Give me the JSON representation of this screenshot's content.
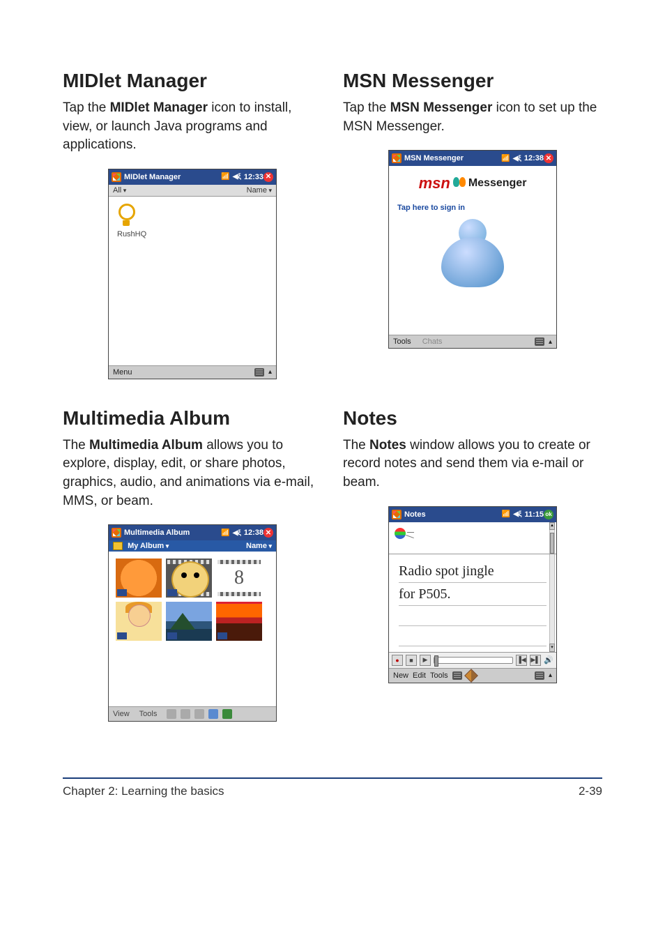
{
  "sections": {
    "midlet": {
      "heading": "MIDlet Manager",
      "desc_pre": "Tap the ",
      "desc_bold": "MIDlet Manager",
      "desc_post": " icon to install, view, or launch Java programs and applications.",
      "shot": {
        "title": "MIDlet Manager",
        "time": "12:33",
        "filter_label": "All",
        "sort_label": "Name",
        "item_label": "RushHQ",
        "menu_label": "Menu"
      }
    },
    "msn": {
      "heading": "MSN Messenger",
      "desc_pre": "Tap the ",
      "desc_bold": "MSN Messenger",
      "desc_post": " icon to set up the MSN Messenger.",
      "shot": {
        "title": "MSN Messenger",
        "time": "12:38",
        "logo_main": "msn",
        "logo_sub": "Messenger",
        "signin": "Tap here to sign in",
        "menu_tools": "Tools",
        "menu_chats": "Chats"
      }
    },
    "album": {
      "heading": "Multimedia Album",
      "desc_pre": "The ",
      "desc_bold": "Multimedia Album",
      "desc_post": " allows you to explore, display, edit, or share photos, graphics, audio, and animations via e-mail, MMS, or beam.",
      "shot": {
        "title": "Multimedia Album",
        "time": "12:38",
        "folder_label": "My Album",
        "sort_label": "Name",
        "thumb3_text": "8",
        "menu_view": "View",
        "menu_tools": "Tools"
      }
    },
    "notes": {
      "heading": "Notes",
      "desc_pre": "The ",
      "desc_bold": "Notes",
      "desc_post": " window allows you to create or record notes and send them via e-mail or beam.",
      "shot": {
        "title": "Notes",
        "time": "11:15",
        "ok": "ok",
        "line1": "Radio spot jingle",
        "line2": "for P505.",
        "menu_new": "New",
        "menu_edit": "Edit",
        "menu_tools": "Tools"
      }
    }
  },
  "footer": {
    "left": "Chapter 2: Learning the basics",
    "right": "2-39"
  }
}
